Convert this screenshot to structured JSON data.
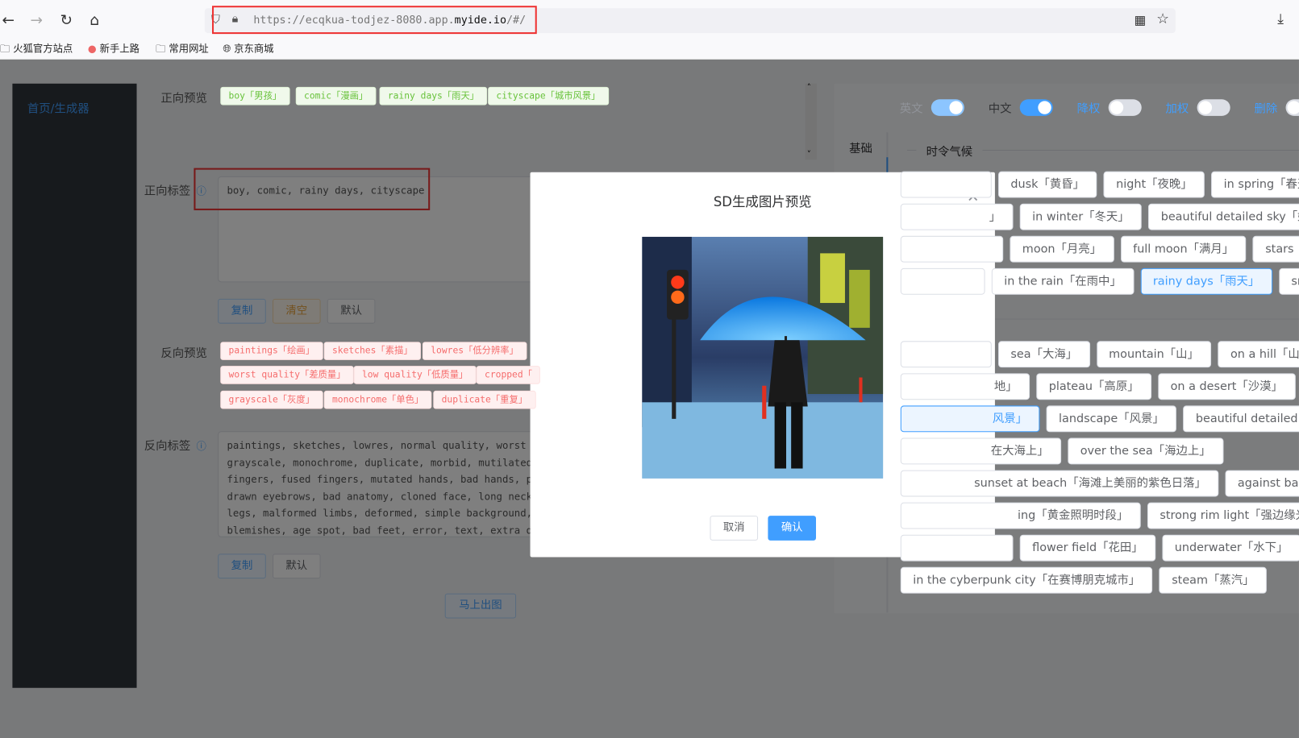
{
  "browser": {
    "url_prefix": "https://ecqkua-todjez-8080.app.",
    "url_domain": "myide.io",
    "url_suffix": "/#/",
    "bookmarks": [
      "火狐官方站点",
      "新手上路",
      "常用网址",
      "京东商城"
    ]
  },
  "sidebar": {
    "item": "首页/生成器"
  },
  "positive": {
    "preview_label": "正向预览",
    "tags": [
      "boy「男孩」",
      "comic「漫画」",
      "rainy days「雨天」",
      "cityscape「城市风景」"
    ],
    "label": "正向标签",
    "value": "boy, comic, rainy days, cityscape",
    "copy": "复制",
    "clear": "清空",
    "default": "默认"
  },
  "negative": {
    "preview_label": "反向预览",
    "tags": [
      "paintings「绘画」",
      "sketches「素描」",
      "lowres「低分辨率」",
      "worst quality「差质量」",
      "low quality「低质量」",
      "cropped「",
      "grayscale「灰度」",
      "monochrome「单色」",
      "duplicate「重复」"
    ],
    "label": "反向标签",
    "value": "paintings, sketches, lowres, normal quality, worst quality\ngrayscale, monochrome, duplicate, morbid, mutilated, m\nfingers, fused fingers, mutated hands, bad hands, poor\ndrawn eyebrows, bad anatomy, cloned face, long neck, e\nlegs, malformed limbs, deformed, simple background, ba\nblemishes, age spot, bad feet, error, text, extra digi",
    "copy": "复制",
    "default": "默认"
  },
  "generate": "马上出图",
  "toggles": [
    {
      "label": "英文",
      "on": true
    },
    {
      "label": "中文",
      "on": true
    },
    {
      "label": "降权",
      "on": false
    },
    {
      "label": "加权",
      "on": false
    },
    {
      "label": "删除",
      "on": false
    }
  ],
  "tab": "基础",
  "section": "时令气候",
  "tag_rows": [
    [
      {
        "t": ""
      },
      {
        "t": "dusk「黄昏」"
      },
      {
        "t": "night「夜晚」"
      },
      {
        "t": "in spring「春天」"
      }
    ],
    [
      {
        "t": "」"
      },
      {
        "t": "in winter「冬天」"
      },
      {
        "t": "beautiful detailed sky「好天」"
      }
    ],
    [
      {
        "t": ""
      },
      {
        "t": "moon「月亮」"
      },
      {
        "t": "full moon「满月」"
      },
      {
        "t": "stars「星星」"
      }
    ],
    [
      {
        "t": ""
      },
      {
        "t": "in the rain「在雨中」"
      },
      {
        "t": "rainy days「雨天」",
        "sel": true
      },
      {
        "t": "snow"
      }
    ],
    [
      {
        "t": ""
      },
      {
        "t": "sea「大海」"
      },
      {
        "t": "mountain「山」"
      },
      {
        "t": "on a hill「山上」"
      }
    ],
    [
      {
        "t": "地」"
      },
      {
        "t": "plateau「高原」"
      },
      {
        "t": "on a desert「沙漠」"
      },
      {
        "t": "i"
      }
    ],
    [
      {
        "t": "风景」",
        "sel": true
      },
      {
        "t": "landscape「风景」"
      },
      {
        "t": "beautiful detailed water"
      }
    ],
    [
      {
        "t": "在大海上」"
      },
      {
        "t": "over the sea「海边上」"
      }
    ],
    [
      {
        "t": "sunset at beach「海滩上美丽的紫色日落」"
      },
      {
        "t": "against backl"
      }
    ],
    [
      {
        "t": "ing「黄金照明时段」"
      },
      {
        "t": "strong rim light「强边缘光」"
      },
      {
        "t": ""
      }
    ],
    [
      {
        "t": ""
      },
      {
        "t": "flower field「花田」"
      },
      {
        "t": "underwater「水下」"
      },
      {
        "t": "e"
      }
    ],
    [
      {
        "t": "in the cyberpunk city「在赛博朋克城市」"
      },
      {
        "t": "steam「蒸汽」"
      }
    ]
  ],
  "modal": {
    "title": "SD生成图片预览",
    "cancel": "取消",
    "confirm": "确认"
  },
  "colors": {
    "primary": "#409eff",
    "success": "#67c23a",
    "danger": "#f56c6c",
    "warning": "#e6a23c"
  }
}
